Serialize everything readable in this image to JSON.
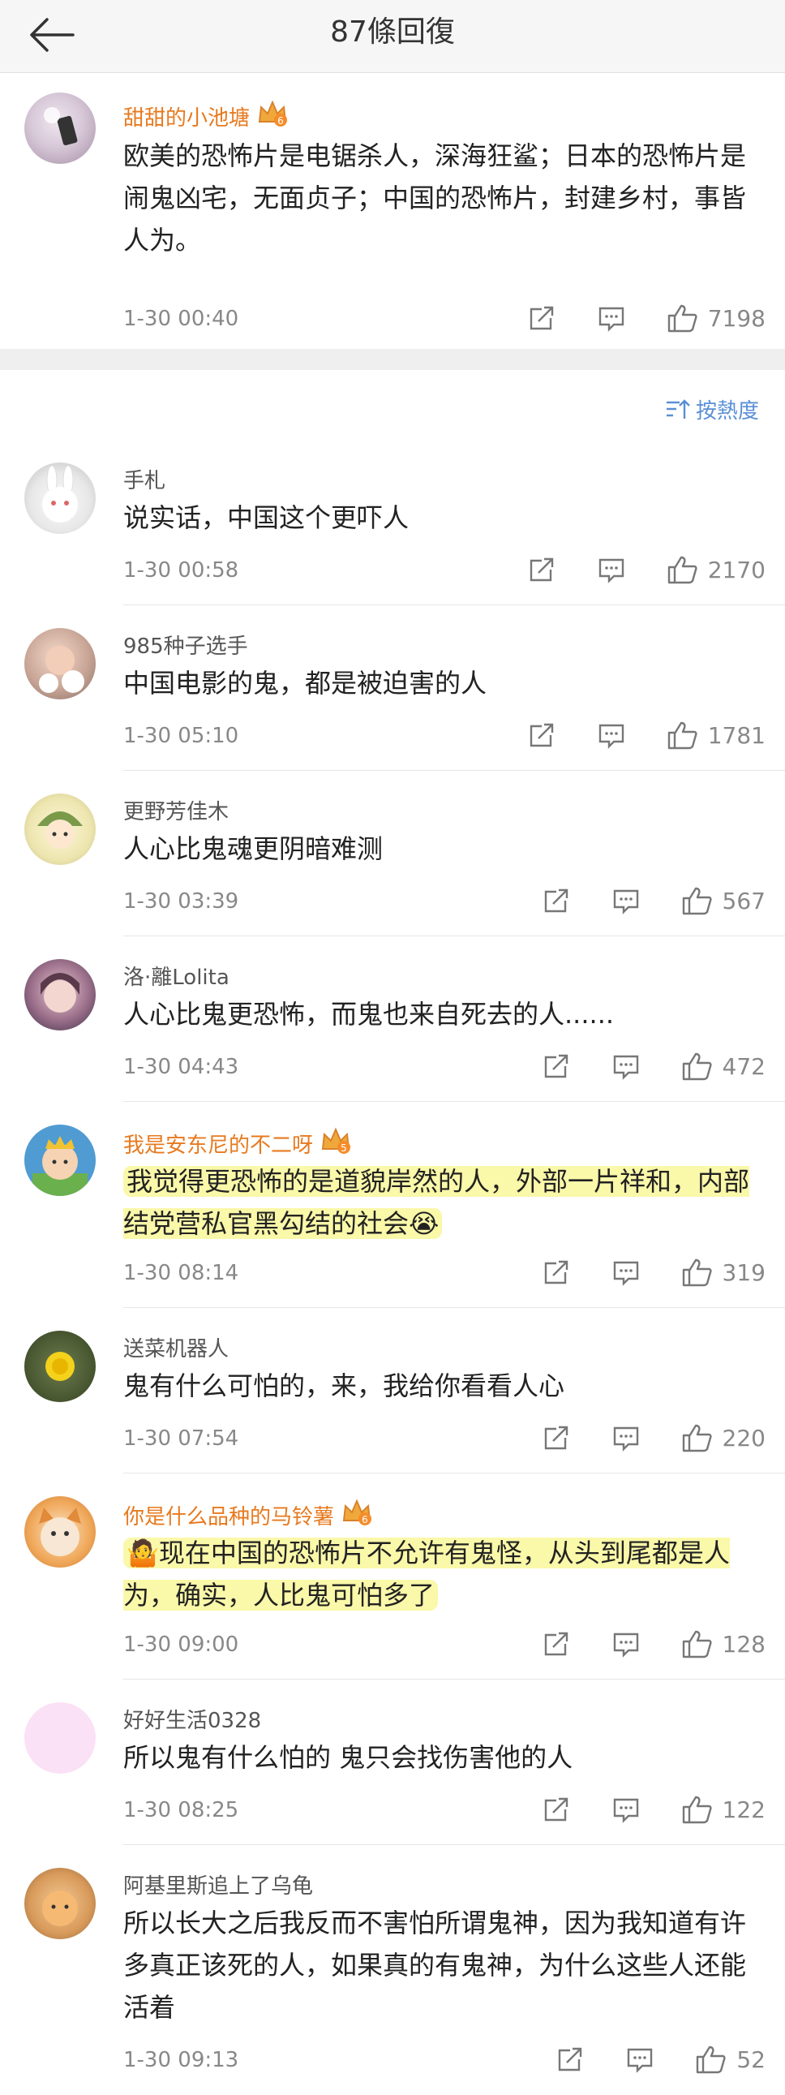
{
  "header": {
    "title": "87條回復"
  },
  "top_comment": {
    "user": "甜甜的小池塘",
    "badge": "6",
    "text": "欧美的恐怖片是电锯杀人，深海狂鲨；日本的恐怖片是闹鬼凶宅，无面贞子；中国的恐怖片，封建乡村，事皆人为。",
    "time": "1-30 00:40",
    "likes": "7198"
  },
  "sort": {
    "label": "按熱度"
  },
  "comments": [
    {
      "user": "手札",
      "text": "说实话，中国这个更吓人",
      "time": "1-30 00:58",
      "likes": "2170"
    },
    {
      "user": "985种子选手",
      "text": "中国电影的鬼，都是被迫害的人",
      "time": "1-30 05:10",
      "likes": "1781"
    },
    {
      "user": "更野芳佳木",
      "text": "人心比鬼魂更阴暗难测",
      "time": "1-30 03:39",
      "likes": "567"
    },
    {
      "user": "洛·離Lolita",
      "text": "人心比鬼更恐怖，而鬼也来自死去的人......",
      "time": "1-30 04:43",
      "likes": "472"
    },
    {
      "user": "我是安东尼的不二呀",
      "badge": "5",
      "text": "我觉得更恐怖的是道貌岸然的人，外部一片祥和，内部结党营私官黑勾结的社会😭",
      "time": "1-30 08:14",
      "likes": "319"
    },
    {
      "user": "送菜机器人",
      "text": "鬼有什么可怕的，来，我给你看看人心",
      "time": "1-30 07:54",
      "likes": "220"
    },
    {
      "user": "你是什么品种的马铃薯",
      "badge": "6",
      "text": "🤷现在中国的恐怖片不允许有鬼怪，从头到尾都是人为，确实，人比鬼可怕多了",
      "time": "1-30 09:00",
      "likes": "128"
    },
    {
      "user": "好好生活0328",
      "text": "所以鬼有什么怕的 鬼只会找伤害他的人",
      "time": "1-30 08:25",
      "likes": "122"
    },
    {
      "user": "阿基里斯追上了乌龟",
      "text": "所以长大之后我反而不害怕所谓鬼神，因为我知道有许多真正该死的人，如果真的有鬼神，为什么这些人还能活着",
      "time": "1-30 09:13",
      "likes": "52"
    }
  ]
}
